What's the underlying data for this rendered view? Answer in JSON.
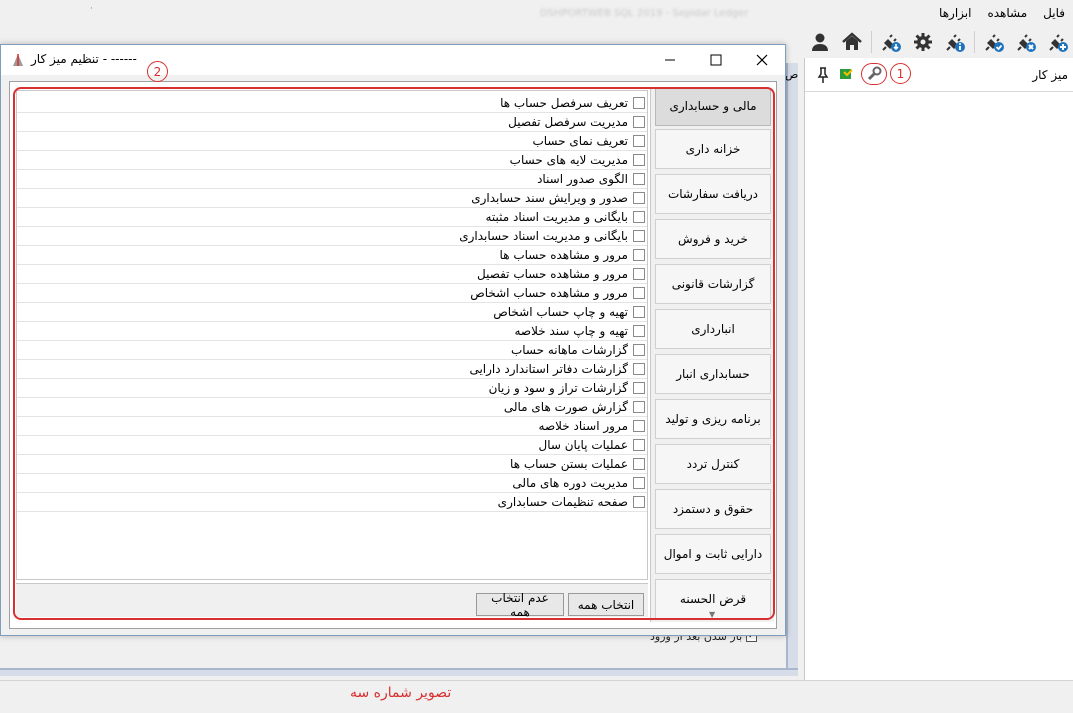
{
  "app": {
    "menu": [
      "فایل",
      "مشاهده",
      "ابزارها"
    ],
    "blurred_title": "DSHPORTWEB SQL 2019 - Sepidar Ledger",
    "toolbar_icons": [
      "plug-add-icon",
      "plug-remove-icon",
      "plug-check-icon",
      "plug-info-icon",
      "settings-gear-icon",
      "plug-download-icon",
      "home-icon",
      "user-icon"
    ]
  },
  "right_panel": {
    "title": "میز کار",
    "icons": [
      "pin-icon",
      "flag-icon",
      "wrench-icon"
    ]
  },
  "markers": {
    "one": "1",
    "two": "2"
  },
  "background": {
    "checkbox_label": "باز شدن بعد از ورود",
    "side_letter": "ص"
  },
  "dialog": {
    "title": "------ - تنظیم میز کار",
    "window_buttons": {
      "minimize": "—",
      "maximize": "☐",
      "close": "✕"
    },
    "items": [
      "تعریف سرفصل حساب ها",
      "مدیریت سرفصل تفصیل",
      "تعریف نمای حساب",
      "مدیریت لایه های حساب",
      "الگوی صدور اسناد",
      "صدور و ویرایش سند حسابداری",
      "بایگانی و مدیریت اسناد مثبته",
      "بایگانی و مدیریت اسناد حسابداری",
      "مرور و مشاهده حساب ها",
      "مرور و مشاهده حساب تفصیل",
      "مرور و مشاهده حساب اشخاص",
      "تهیه و چاپ حساب اشخاص",
      "تهیه و چاپ سند خلاصه",
      "گزارشات ماهانه حساب",
      "گزارشات دفاتر استاندارد دارایی",
      "گزارشات تراز و سود و زیان",
      "گزارش صورت های مالی",
      "مرور اسناد خلاصه",
      "عملیات پایان سال",
      "عملیات بستن حساب ها",
      "مدیریت دوره های مالی",
      "صفحه تنظیمات حسابداری"
    ],
    "categories": [
      "مالی و حسابداری",
      "خزانه داری",
      "دریافت سفارشات",
      "خرید و فروش",
      "گزارشات قانونی",
      "انبارداری",
      "حسابداری انبار",
      "برنامه ریزی و تولید",
      "کنترل تردد",
      "حقوق و دستمزد",
      "دارایی ثابت و اموال",
      "قرض الحسنه"
    ],
    "selected_category": "مالی و حسابداری",
    "select_all": "انتخاب همه",
    "unselect_all": "عدم انتخاب همه"
  },
  "caption": "تصویر شماره سه",
  "colors": {
    "annotation_red": "#d83030",
    "accent_blue": "#1e73be"
  }
}
